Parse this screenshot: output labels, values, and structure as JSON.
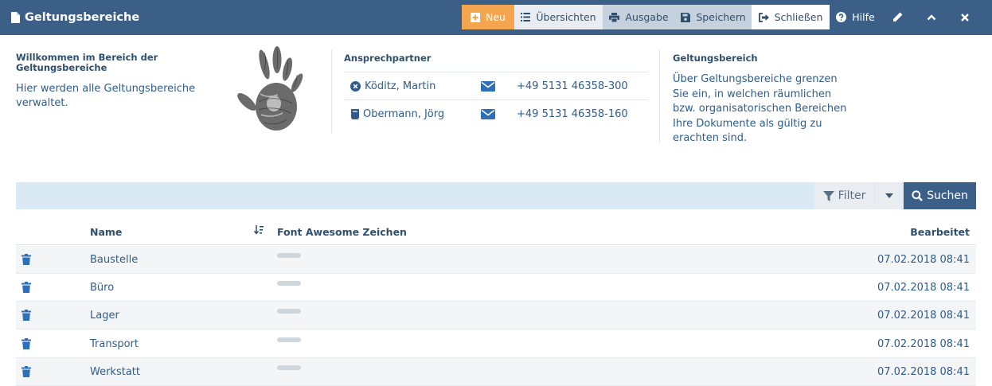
{
  "header": {
    "title": "Geltungsbereiche",
    "buttons": {
      "neu": "Neu",
      "uebersichten": "Übersichten",
      "ausgabe": "Ausgabe",
      "speichern": "Speichern",
      "schliessen": "Schließen",
      "hilfe": "Hilfe"
    },
    "icon_buttons": [
      "pencil-icon",
      "chevron-up-icon",
      "close-icon"
    ]
  },
  "welcome": {
    "title": "Willkommen im Bereich der Geltungsbereiche",
    "text": "Hier werden alle Geltungsbereiche verwaltet."
  },
  "contacts": {
    "title": "Ansprechpartner",
    "items": [
      {
        "name": "Köditz, Martin",
        "phone": "+49 5131 46358-300",
        "status_icon": "x-circle-icon"
      },
      {
        "name": "Obermann, Jörg",
        "phone": "+49 5131 46358-160",
        "status_icon": "book-icon"
      }
    ]
  },
  "info": {
    "title": "Geltungsbereich",
    "text": "Über Geltungsbereiche grenzen Sie ein, in welchen räumlichen bzw. organisatorischen Bereichen Ihre Dokumente als gültig zu erachten sind."
  },
  "search": {
    "filter_label": "Filter",
    "search_label": "Suchen"
  },
  "table": {
    "columns": {
      "name": "Name",
      "fa": "Font Awesome Zeichen",
      "edited": "Bearbeitet"
    },
    "rows": [
      {
        "name": "Baustelle",
        "edited": "07.02.2018 08:41"
      },
      {
        "name": "Büro",
        "edited": "07.02.2018 08:41"
      },
      {
        "name": "Lager",
        "edited": "07.02.2018 08:41"
      },
      {
        "name": "Transport",
        "edited": "07.02.2018 08:41"
      },
      {
        "name": "Werkstatt",
        "edited": "07.02.2018 08:41"
      }
    ]
  },
  "colors": {
    "header_bg": "#3b5f87",
    "accent_orange": "#f3a54f",
    "search_bar": "#d9eaf5",
    "link_blue": "#2f5c8c"
  }
}
